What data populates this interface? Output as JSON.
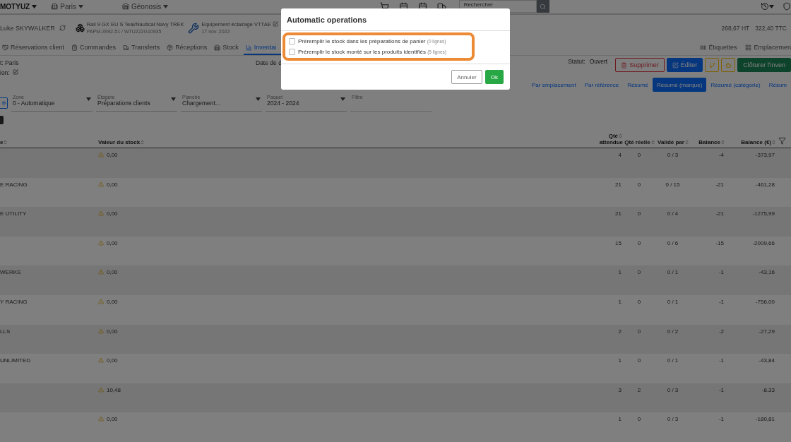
{
  "top_bar": {
    "account": "MOTYUZ",
    "location": "Paris",
    "site": "Géonosis",
    "search": {
      "placeholder": "Rechercher"
    }
  },
  "context_bar": {
    "user": "Luke SKYWALKER",
    "product": {
      "title": "Rail 9 GX EU S Teal/Nautical Navy TREK",
      "reference": "PAPM-3992-51 / WTU222G10935"
    },
    "job": {
      "title": "Equipement éclairage VTTAE",
      "date": "17 nov. 2022"
    },
    "total_ht": "268,67 HT",
    "total_ttc": "322,40 TTC"
  },
  "nav_tabs": [
    {
      "kind": "reservations",
      "label": "Réservations client",
      "selected": false
    },
    {
      "kind": "orders",
      "label": "Commandes",
      "selected": false
    },
    {
      "kind": "transfers",
      "label": "Transferts",
      "selected": false
    },
    {
      "kind": "receptions",
      "label": "Réceptions",
      "selected": false
    },
    {
      "kind": "stock",
      "label": "Stock",
      "selected": false
    },
    {
      "kind": "inventory",
      "label": "Inventai",
      "selected": true
    }
  ],
  "nav_links": [
    {
      "kind": "labels",
      "label": "Étiquettes"
    },
    {
      "kind": "locations",
      "label": "Emplacemen"
    }
  ],
  "info": {
    "shop": "t: Paris",
    "description": "ion:",
    "date_label": "Date de d"
  },
  "status": {
    "label": "Statut:",
    "value": "Ouvert"
  },
  "actions": [
    {
      "kind": "delete",
      "label": "Supprimer"
    },
    {
      "kind": "edit",
      "label": "Éditer"
    },
    {
      "kind": "branch"
    },
    {
      "kind": "robot"
    },
    {
      "kind": "close",
      "label": "Clôturer l'inven"
    }
  ],
  "view_tabs": [
    {
      "label": "Par emplacement",
      "selected": false
    },
    {
      "label": "Par référence",
      "selected": false
    },
    {
      "label": "Résumé",
      "selected": false
    },
    {
      "label": "Résumé (marque)",
      "selected": true
    },
    {
      "label": "Résumé (catégorie)",
      "selected": false
    },
    {
      "label": "Résum",
      "selected": false
    }
  ],
  "filters": [
    {
      "label": "Zone",
      "value": "0 - Automatique"
    },
    {
      "label": "Étagère",
      "value": "Préparations clients"
    },
    {
      "label": "Planche",
      "value": "Chargement..."
    },
    {
      "label": "Paquet",
      "value": "2024 - 2024"
    },
    {
      "label": "Filtre"
    }
  ],
  "table": {
    "columns": [
      {
        "label": "e"
      },
      {
        "label": "Valeur du stock"
      },
      {
        "label": "Qté",
        "label_2": "attendue"
      },
      {
        "label": "Qté réelle"
      },
      {
        "label": "Validé par"
      },
      {
        "label": "Balance"
      },
      {
        "label": "Balance (€)"
      }
    ],
    "rows": [
      {
        "name": "",
        "value": "0,00",
        "warning": true,
        "expected": "4",
        "real": "0",
        "validated": "0 / 3",
        "balance": "-4",
        "balance_eur": "-373,97"
      },
      {
        "name": "E RACING",
        "value": "0,00",
        "warning": true,
        "expected": "21",
        "real": "0",
        "validated": "0 / 15",
        "balance": "-21",
        "balance_eur": "-461,28"
      },
      {
        "name": "E UTILITY",
        "value": "0,00",
        "warning": true,
        "expected": "21",
        "real": "0",
        "validated": "0 / 4",
        "balance": "-21",
        "balance_eur": "-1275,99"
      },
      {
        "name": "",
        "value": "0,00",
        "warning": true,
        "expected": "15",
        "real": "0",
        "validated": "0 / 6",
        "balance": "-15",
        "balance_eur": "-2009,66"
      },
      {
        "name": "WERKS",
        "value": "0,00",
        "warning": true,
        "expected": "1",
        "real": "0",
        "validated": "0 / 1",
        "balance": "-1",
        "balance_eur": "-43,16"
      },
      {
        "name": "Y RACING",
        "value": "0,00",
        "warning": true,
        "expected": "1",
        "real": "0",
        "validated": "0 / 1",
        "balance": "-1",
        "balance_eur": "-756,00"
      },
      {
        "name": "LLS",
        "value": "0,00",
        "warning": true,
        "expected": "2",
        "real": "0",
        "validated": "0 / 2",
        "balance": "-2",
        "balance_eur": "-27,29"
      },
      {
        "name": "UNLIMITED",
        "value": "0,00",
        "warning": true,
        "expected": "1",
        "real": "0",
        "validated": "0 / 1",
        "balance": "-1",
        "balance_eur": "-43,84"
      },
      {
        "name": "",
        "value": "10,48",
        "warning": true,
        "expected": "3",
        "real": "2",
        "validated": "0 / 3",
        "balance": "-1",
        "balance_eur": "-8,33"
      },
      {
        "name": "",
        "value": "0,00",
        "warning": true,
        "expected": "1",
        "real": "0",
        "validated": "0 / 3",
        "balance": "-1",
        "balance_eur": "-180,81"
      }
    ]
  },
  "modal": {
    "title": "Automatic operations",
    "options": [
      {
        "label": "Préremplir le stock dans les préparations de panier",
        "count": "(0 lignes)",
        "checked": false
      },
      {
        "label": "Préremplir le stock monté sur les produits identifiés",
        "count": "(5 lignes)",
        "checked": false
      }
    ],
    "cancel": "Annuler",
    "ok": "Ok"
  }
}
